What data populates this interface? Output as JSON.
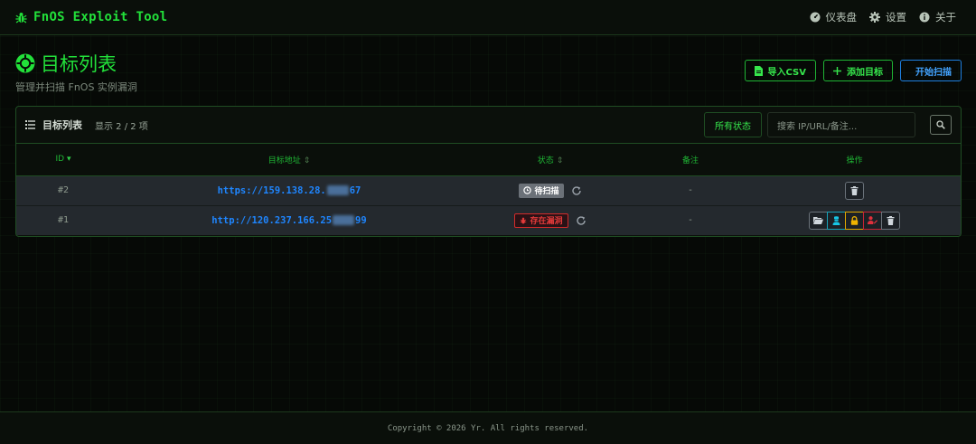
{
  "app": {
    "title": "FnOS Exploit Tool",
    "icon": "bug-icon"
  },
  "nav": [
    {
      "label": "仪表盘",
      "icon": "dashboard-icon"
    },
    {
      "label": "设置",
      "icon": "gear-icon"
    },
    {
      "label": "关于",
      "icon": "info-icon"
    }
  ],
  "page": {
    "title": "目标列表",
    "subtitle": "管理并扫描 FnOS 实例漏洞",
    "actions": {
      "import_csv": "导入CSV",
      "add_target": "添加目标",
      "start_scan": "开始扫描"
    }
  },
  "card": {
    "title": "目标列表",
    "count": "显示 2 / 2 项",
    "filter_value": "所有状态",
    "search_placeholder": "搜索 IP/URL/备注..."
  },
  "table": {
    "headers": {
      "id": "ID",
      "target": "目标地址",
      "status": "状态",
      "note": "备注",
      "ops": "操作"
    },
    "rows": [
      {
        "id": "#2",
        "target_prefix": "https://159.138.28.",
        "target_suffix": "67",
        "status": "待扫描",
        "status_type": "pending",
        "note": "-",
        "ops": [
          "delete"
        ]
      },
      {
        "id": "#1",
        "target_prefix": "http://120.237.166.25",
        "target_suffix": "99",
        "status": "存在漏洞",
        "status_type": "vulnerable",
        "note": "-",
        "ops": [
          "folder",
          "shell",
          "lock",
          "exploit",
          "delete"
        ]
      }
    ]
  },
  "footer": {
    "text": "Copyright © 2026 Yr. All rights reserved."
  },
  "colors": {
    "accent_green": "#22e03a",
    "accent_blue": "#1f86ff",
    "danger": "#e33a3a",
    "row_bg": "#24292e"
  }
}
